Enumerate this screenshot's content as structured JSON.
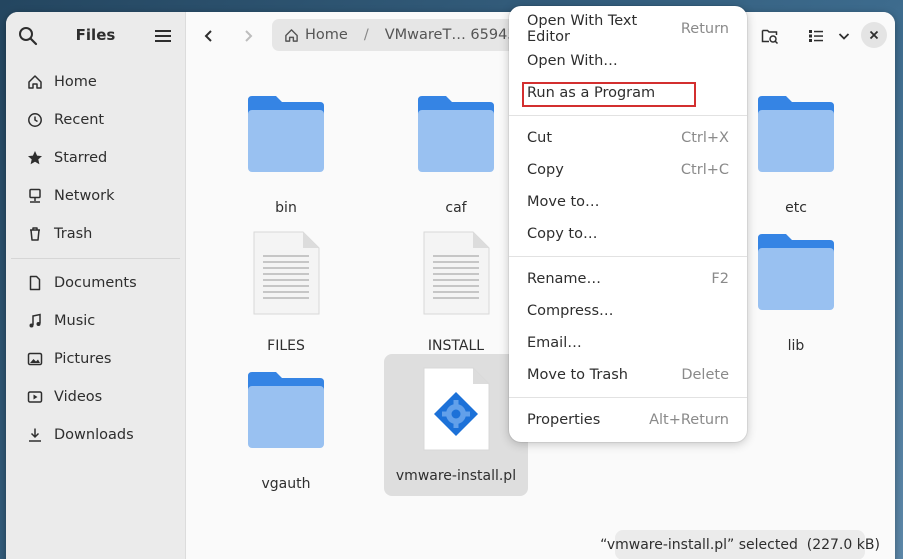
{
  "app": {
    "title": "Files"
  },
  "sidebar": {
    "places": [
      {
        "label": "Home",
        "icon": "home-icon"
      },
      {
        "label": "Recent",
        "icon": "clock-icon"
      },
      {
        "label": "Starred",
        "icon": "star-icon"
      },
      {
        "label": "Network",
        "icon": "network-icon"
      },
      {
        "label": "Trash",
        "icon": "trash-icon"
      }
    ],
    "bookmarks": [
      {
        "label": "Documents",
        "icon": "document-icon"
      },
      {
        "label": "Music",
        "icon": "music-icon"
      },
      {
        "label": "Pictures",
        "icon": "picture-icon"
      },
      {
        "label": "Videos",
        "icon": "video-icon"
      },
      {
        "label": "Downloads",
        "icon": "download-icon"
      }
    ]
  },
  "pathbar": {
    "home_label": "Home",
    "separator": "/",
    "current_label": "VMwareT… 659455"
  },
  "files": [
    {
      "name": "bin",
      "type": "folder"
    },
    {
      "name": "caf",
      "type": "folder"
    },
    {
      "name": "etc",
      "type": "folder"
    },
    {
      "name": "FILES",
      "type": "text"
    },
    {
      "name": "INSTALL",
      "type": "text"
    },
    {
      "name": "lib",
      "type": "folder"
    },
    {
      "name": "vgauth",
      "type": "folder"
    },
    {
      "name": "vmware-install.pl",
      "type": "script",
      "selected": true
    }
  ],
  "context_menu": {
    "group1": [
      {
        "label": "Open With Text Editor",
        "accel": "Return"
      },
      {
        "label": "Open With…",
        "accel": ""
      },
      {
        "label": "Run as a Program",
        "accel": ""
      }
    ],
    "group2": [
      {
        "label": "Cut",
        "accel": "Ctrl+X"
      },
      {
        "label": "Copy",
        "accel": "Ctrl+C"
      },
      {
        "label": "Move to…",
        "accel": ""
      },
      {
        "label": "Copy to…",
        "accel": ""
      }
    ],
    "group3": [
      {
        "label": "Rename…",
        "accel": "F2"
      },
      {
        "label": "Compress…",
        "accel": ""
      },
      {
        "label": "Email…",
        "accel": ""
      },
      {
        "label": "Move to Trash",
        "accel": "Delete"
      }
    ],
    "group4": [
      {
        "label": "Properties",
        "accel": "Alt+Return"
      }
    ]
  },
  "status": {
    "text": "“vmware-install.pl” selected  (227.0 kB)"
  },
  "colors": {
    "folder_back": "#3584e4",
    "folder_front": "#99c1f1",
    "highlight": "#d32f2f"
  }
}
